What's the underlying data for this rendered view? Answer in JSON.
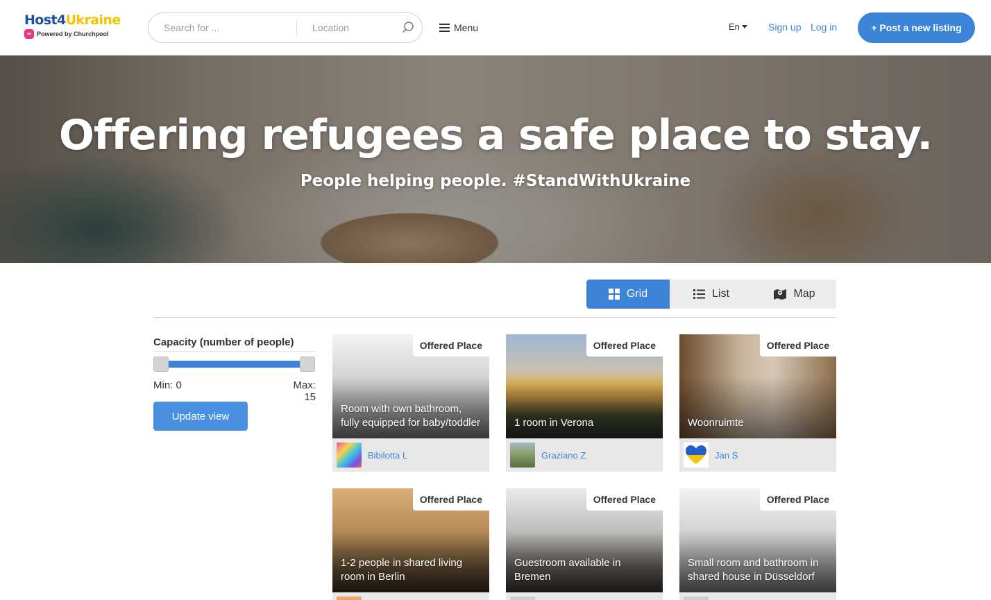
{
  "brand": {
    "title_part1": "Host4",
    "title_part2": "Ukraine",
    "powered_by": "Powered by Churchpool",
    "badge": "∞"
  },
  "search": {
    "query_placeholder": "Search for ...",
    "location_placeholder": "Location"
  },
  "nav": {
    "menu_label": "Menu",
    "language": "En",
    "signup": "Sign up",
    "login": "Log in",
    "post_listing": "+ Post a new listing"
  },
  "hero": {
    "title": "Offering refugees a safe place to stay.",
    "subtitle": "People helping people. #StandWithUkraine"
  },
  "view_toggle": {
    "grid": "Grid",
    "list": "List",
    "map": "Map",
    "active": "grid"
  },
  "filter": {
    "title": "Capacity (number of people)",
    "min_label": "Min: 0",
    "max_label": "Max: 15",
    "min": 0,
    "max": 15,
    "update_button": "Update view"
  },
  "listings": [
    {
      "badge": "Offered Place",
      "title": "Room with own bathroom, fully equipped for baby/toddler",
      "owner": "Bibilotta L",
      "image": "blank",
      "avatar": "colorful"
    },
    {
      "badge": "Offered Place",
      "title": "1 room in Verona",
      "owner": "Graziano Z",
      "image": "verona",
      "avatar": "field"
    },
    {
      "badge": "Offered Place",
      "title": "Woonruimte",
      "owner": "Jan S",
      "image": "woon",
      "avatar": "ukraine-heart"
    },
    {
      "badge": "Offered Place",
      "title": "1-2 people in shared living room in Berlin",
      "owner": "",
      "image": "berlin",
      "avatar": "person"
    },
    {
      "badge": "Offered Place",
      "title": "Guestroom available in Bremen",
      "owner": "",
      "image": "bremen",
      "avatar": "grey"
    },
    {
      "badge": "Offered Place",
      "title": "Small room and bathroom in shared house in Düsseldorf",
      "owner": "",
      "image": "blank",
      "avatar": "grey"
    }
  ],
  "colors": {
    "accent": "#3c84d8",
    "brand_blue": "#1d4ea5",
    "brand_yellow": "#f5c400"
  }
}
